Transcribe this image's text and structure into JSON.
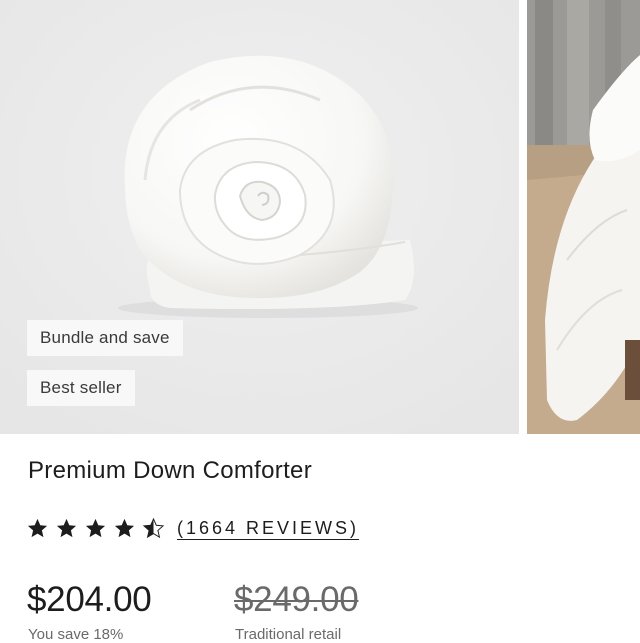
{
  "product": {
    "badges": [
      "Bundle and save",
      "Best seller"
    ],
    "title": "Premium Down Comforter",
    "rating": {
      "value": 4.5,
      "max": 5,
      "reviews_label": "(1664 REVIEWS)"
    },
    "price": "$204.00",
    "savings": "You save 18%",
    "original_price": "$249.00",
    "original_price_label": "Traditional retail"
  },
  "images": [
    {
      "name": "rolled-comforter-photo"
    },
    {
      "name": "bedroom-comforter-photo"
    }
  ],
  "colors": {
    "image_bg": "#ebebeb",
    "badge_bg": "#f8f8f8",
    "text": "#1d1d1d",
    "muted": "#6a6a6a",
    "star": "#1d1d1d"
  }
}
